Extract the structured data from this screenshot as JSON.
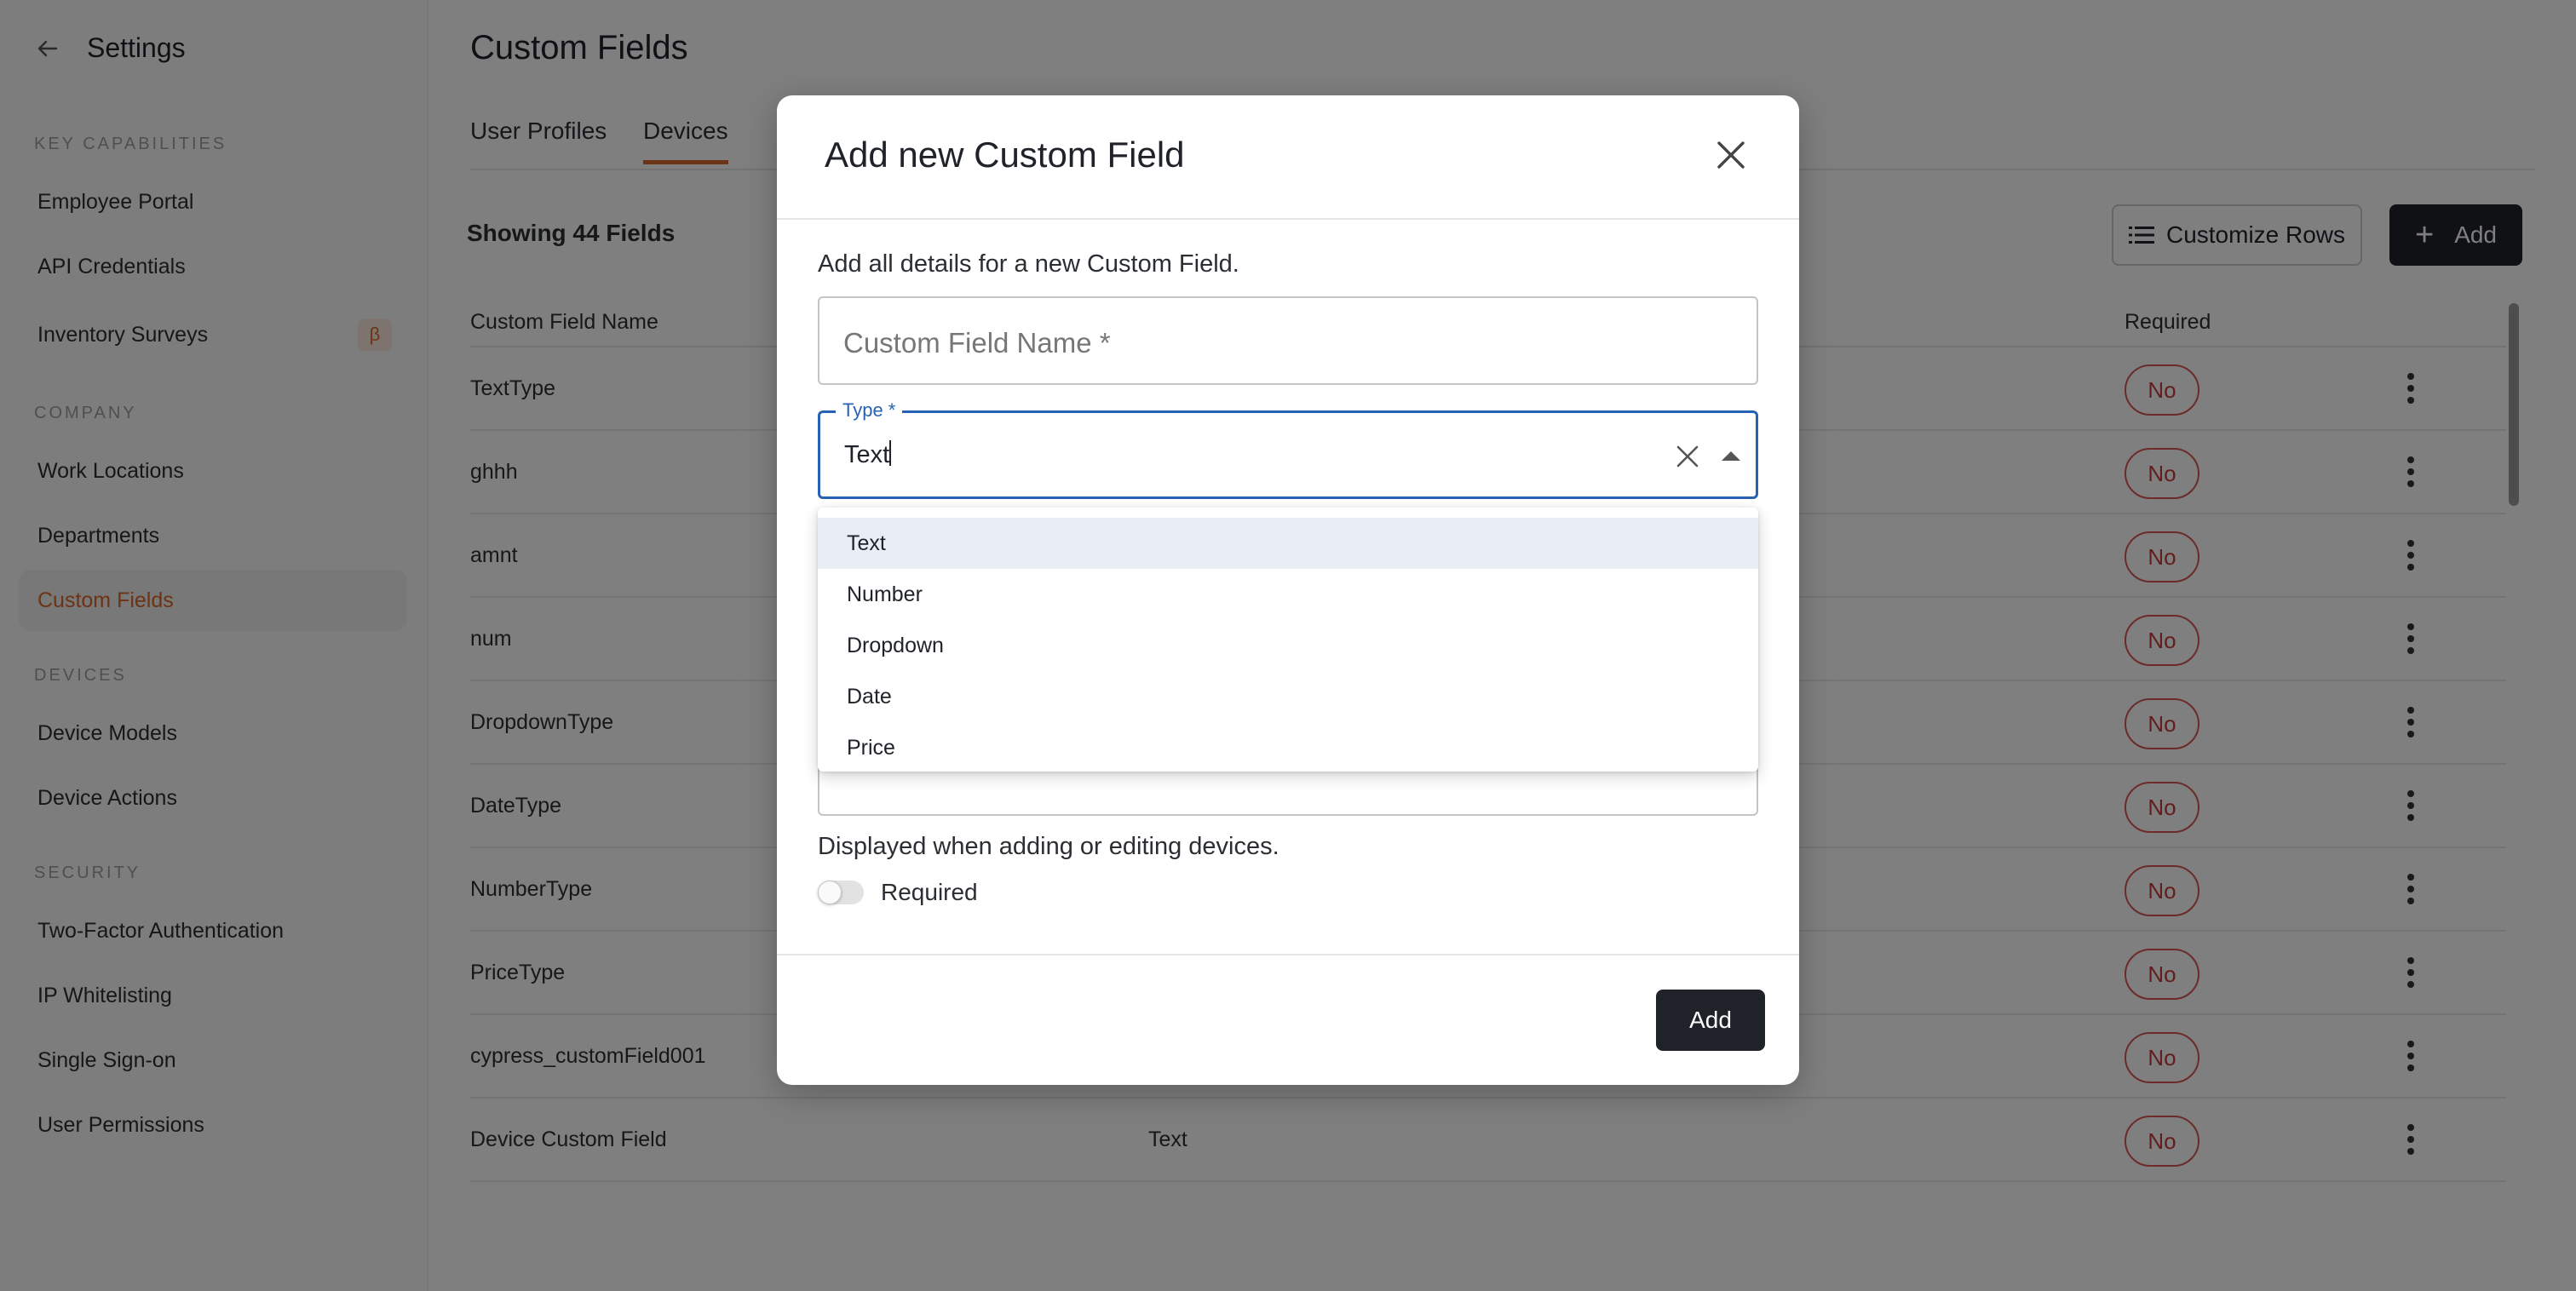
{
  "sidebar": {
    "title": "Settings",
    "sections": {
      "key_capabilities": "Key Capabilities",
      "company": "Company",
      "devices": "Devices",
      "security": "Security"
    },
    "items": {
      "employee_portal": "Employee Portal",
      "api_credentials": "API Credentials",
      "inventory_surveys": "Inventory Surveys",
      "inventory_surveys_badge": "β",
      "work_locations": "Work Locations",
      "departments": "Departments",
      "custom_fields": "Custom Fields",
      "device_models": "Device Models",
      "device_actions": "Device Actions",
      "two_factor": "Two-Factor Authentication",
      "ip_whitelisting": "IP Whitelisting",
      "sso": "Single Sign-on",
      "user_permissions": "User Permissions"
    },
    "active_item": "Custom Fields"
  },
  "main": {
    "title": "Custom Fields",
    "tabs": [
      "User Profiles",
      "Devices"
    ],
    "active_tab": "Devices",
    "showing": "Showing 44 Fields",
    "customize_rows": "Customize Rows",
    "add": "Add",
    "columns": {
      "name": "Custom Field Name",
      "required": "Required"
    },
    "rows": [
      {
        "name": "TextType",
        "type": "",
        "required": "No"
      },
      {
        "name": "ghhh",
        "type": "",
        "required": "No"
      },
      {
        "name": "amnt",
        "type": "",
        "required": "No"
      },
      {
        "name": "num",
        "type": "",
        "required": "No"
      },
      {
        "name": "DropdownType",
        "type": "",
        "required": "No"
      },
      {
        "name": "DateType",
        "type": "",
        "required": "No"
      },
      {
        "name": "NumberType",
        "type": "",
        "required": "No"
      },
      {
        "name": "PriceType",
        "type": "",
        "required": "No"
      },
      {
        "name": "cypress_customField001",
        "type": "",
        "required": "No"
      },
      {
        "name": "Device Custom Field",
        "type": "Text",
        "required": "No"
      }
    ]
  },
  "modal": {
    "title": "Add new Custom Field",
    "description": "Add all details for a new Custom Field.",
    "name_placeholder": "Custom Field Name *",
    "type_label": "Type *",
    "type_value": "Text",
    "type_options": [
      "Text",
      "Number",
      "Dropdown",
      "Date",
      "Price"
    ],
    "selected_option": "Text",
    "display_note": "Displayed when adding or editing devices.",
    "required_label": "Required",
    "required_on": false,
    "submit": "Add"
  },
  "colors": {
    "accent": "#d9662a",
    "focus": "#2862b5",
    "dark_button": "#1f2329",
    "badge_red": "#c73b3b"
  }
}
